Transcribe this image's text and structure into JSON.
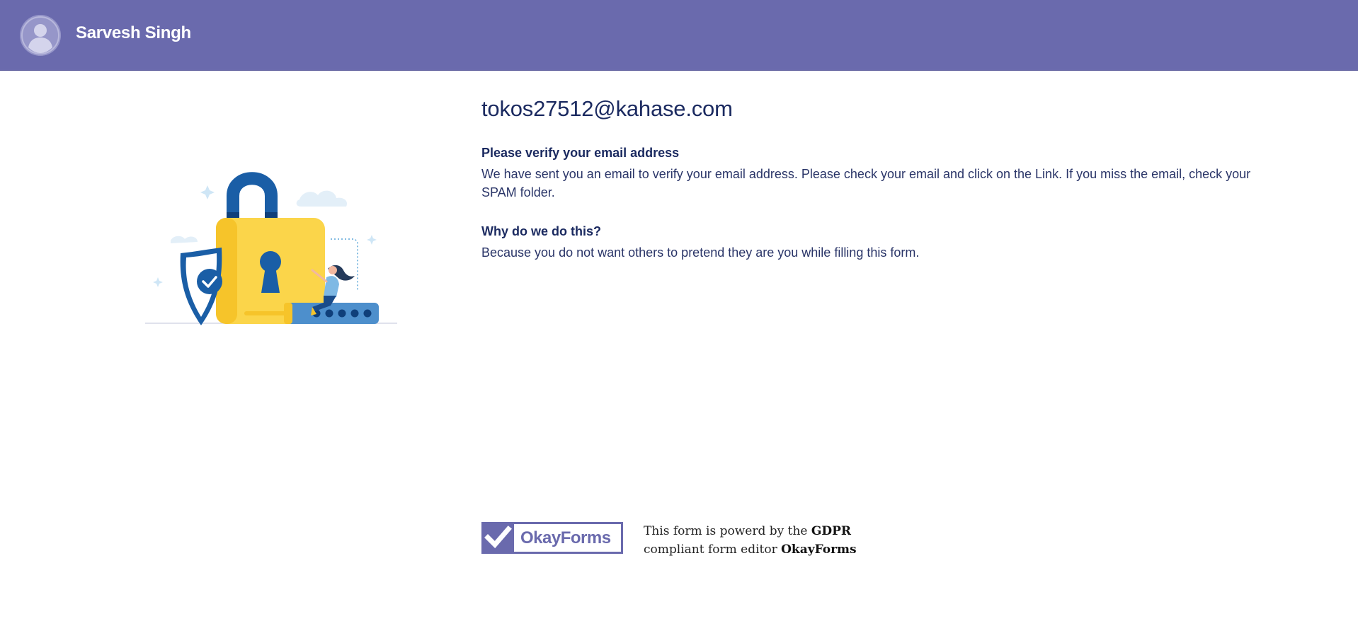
{
  "header": {
    "user_name": "Sarvesh Singh",
    "background_color": "#6a6aad",
    "avatar_icon": "user-avatar-icon"
  },
  "main": {
    "email": "tokos27512@kahase.com",
    "verify_title": "Please verify your email address",
    "verify_text": "We have sent you an email to verify your email address. Please check your email and click on the Link. If you miss the email, check your SPAM folder.",
    "why_title": "Why do we do this?",
    "why_text": "Because you do not want others to pretend they are you while filling this form.",
    "illustration": "padlock-security-illustration"
  },
  "footer": {
    "logo_text": "OkayForms",
    "powered_prefix": "This form is powerd by the ",
    "powered_gdpr": "GDPR",
    "powered_middle": "compliant form editor ",
    "powered_brand": "OkayForms",
    "logo_color": "#6a6aad"
  }
}
